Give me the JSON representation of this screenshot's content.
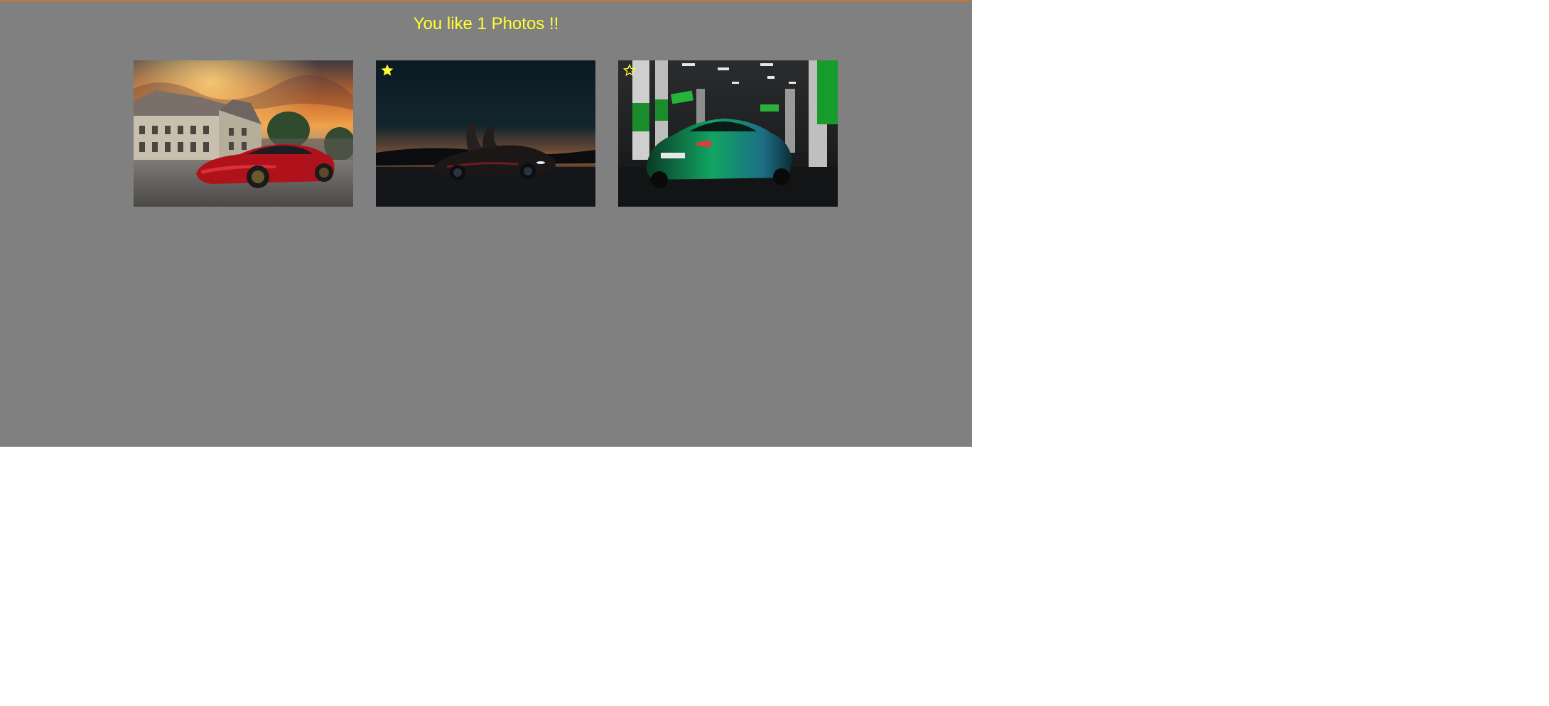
{
  "header": {
    "title": "You like 1 Photos !!"
  },
  "photos": [
    {
      "subject": "red sports car in front of chateau at sunset",
      "liked": null
    },
    {
      "subject": "dark sports car with open doors at dusk",
      "liked": true,
      "star_icon": "star-filled-icon"
    },
    {
      "subject": "green sports car in parking garage",
      "liked": false,
      "star_icon": "star-outline-icon"
    }
  ],
  "colors": {
    "background": "#808080",
    "title": "#ffff33",
    "accent_border": "#c8762e",
    "star": "#ffff33"
  }
}
